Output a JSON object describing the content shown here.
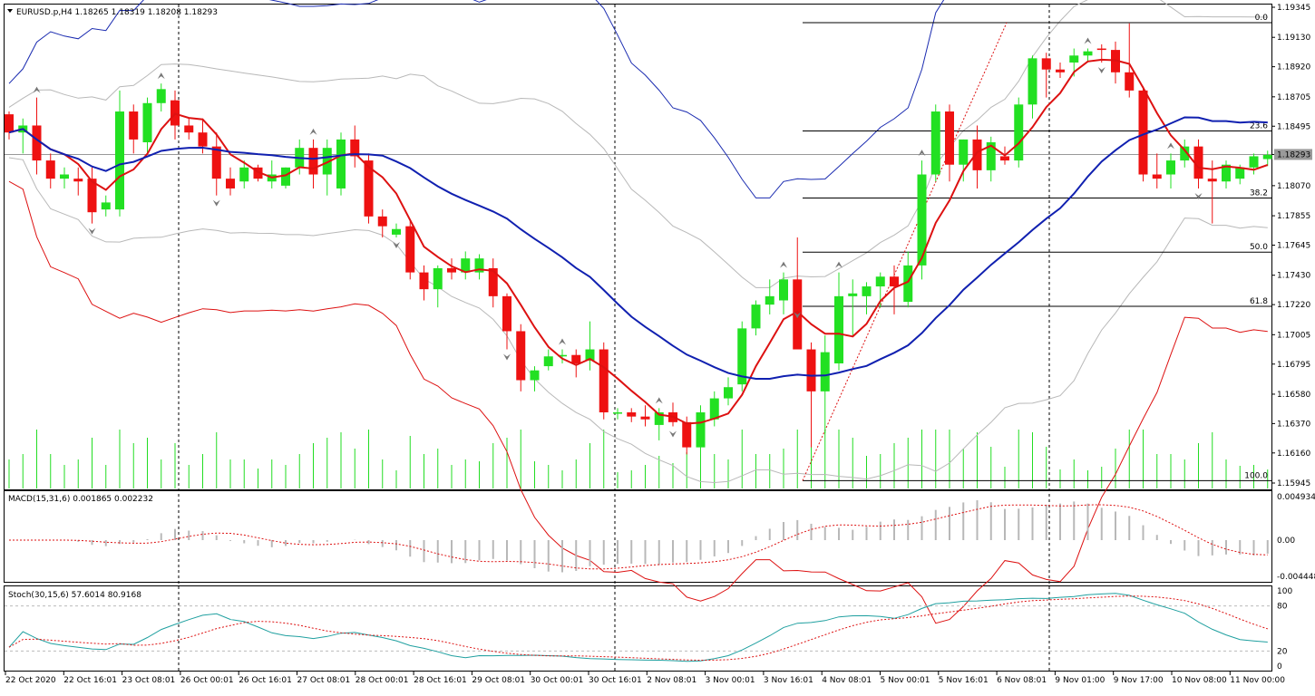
{
  "header": {
    "main": "EURUSD.p,H4  1.18265 1.18319 1.18208 1.18293",
    "macd": "MACD(15,31,6) 0.001865 0.002232",
    "stoch": "Stoch(30,15,6) 57.6014 80.9168"
  },
  "colors": {
    "bull": "#22e022",
    "bear": "#ee1111",
    "ma_fast": "#dd1111",
    "ma_mid": "#1020b0",
    "bb_outer_upper": "#1a2bb0",
    "bb_outer_lower": "#dd1111",
    "bb_inner": "#b8b8b8",
    "fibo": "#000000",
    "stoch_main": "#20a0a0",
    "stoch_signal": "#dd1111",
    "macd_hist": "#b8b8b8",
    "macd_signal": "#dd1111"
  },
  "price_axis": {
    "labels": [
      "1.19345",
      "1.19130",
      "1.18920",
      "1.18705",
      "1.18495",
      "1.18293",
      "1.18070",
      "1.17855",
      "1.17645",
      "1.17430",
      "1.17220",
      "1.17005",
      "1.16795",
      "1.16580",
      "1.16370",
      "1.16160",
      "1.15945"
    ],
    "current_price": "1.18293"
  },
  "macd_axis": [
    "0.004934",
    "0.00",
    "-0.004448"
  ],
  "stoch_axis": [
    "100",
    "80",
    "20",
    "0"
  ],
  "time_axis": [
    "22 Oct 2020",
    "22 Oct 16:01",
    "23 Oct 08:01",
    "26 Oct 00:01",
    "26 Oct 16:01",
    "27 Oct 08:01",
    "28 Oct 00:01",
    "28 Oct 16:01",
    "29 Oct 08:01",
    "30 Oct 00:01",
    "30 Oct 16:01",
    "2 Nov 08:01",
    "3 Nov 00:01",
    "3 Nov 16:01",
    "4 Nov 08:01",
    "5 Nov 00:01",
    "5 Nov 16:01",
    "6 Nov 08:01",
    "9 Nov 01:00",
    "9 Nov 17:00",
    "10 Nov 08:00",
    "11 Nov 00:00"
  ],
  "fibo_levels": [
    {
      "label": "0.0",
      "price": 1.19235
    },
    {
      "label": "23.6",
      "price": 1.18461
    },
    {
      "label": "38.2",
      "price": 1.17982
    },
    {
      "label": "50.0",
      "price": 1.17595
    },
    {
      "label": "61.8",
      "price": 1.17208
    },
    {
      "label": "100.0",
      "price": 1.15962
    }
  ],
  "chart_data": {
    "type": "candlestick",
    "symbol": "EURUSD.p",
    "timeframe": "H4",
    "ohlc_last": {
      "open": 1.18265,
      "high": 1.18319,
      "low": 1.18208,
      "close": 1.18293
    },
    "ylim": [
      1.15945,
      1.19345
    ],
    "candles": [
      [
        1.1858,
        1.186,
        1.184,
        1.1845
      ],
      [
        1.1845,
        1.1855,
        1.183,
        1.185
      ],
      [
        1.185,
        1.187,
        1.1815,
        1.1825
      ],
      [
        1.1825,
        1.183,
        1.1805,
        1.1812
      ],
      [
        1.1812,
        1.182,
        1.1805,
        1.1815
      ],
      [
        1.1812,
        1.182,
        1.18,
        1.181
      ],
      [
        1.1812,
        1.182,
        1.178,
        1.1788
      ],
      [
        1.179,
        1.18,
        1.1785,
        1.1795
      ],
      [
        1.179,
        1.1875,
        1.1785,
        1.186
      ],
      [
        1.186,
        1.1865,
        1.183,
        1.184
      ],
      [
        1.1838,
        1.187,
        1.183,
        1.1866
      ],
      [
        1.1866,
        1.188,
        1.186,
        1.1876
      ],
      [
        1.1868,
        1.1875,
        1.184,
        1.185
      ],
      [
        1.185,
        1.1855,
        1.184,
        1.1845
      ],
      [
        1.1845,
        1.1855,
        1.183,
        1.1835
      ],
      [
        1.1835,
        1.1845,
        1.18,
        1.1812
      ],
      [
        1.1812,
        1.182,
        1.18,
        1.1805
      ],
      [
        1.181,
        1.1825,
        1.1805,
        1.182
      ],
      [
        1.182,
        1.1822,
        1.181,
        1.1812
      ],
      [
        1.181,
        1.1825,
        1.1805,
        1.1815
      ],
      [
        1.1807,
        1.182,
        1.1805,
        1.182
      ],
      [
        1.182,
        1.184,
        1.1815,
        1.1834
      ],
      [
        1.1834,
        1.184,
        1.1805,
        1.1815
      ],
      [
        1.1815,
        1.184,
        1.18,
        1.1834
      ],
      [
        1.1805,
        1.1845,
        1.18,
        1.184
      ],
      [
        1.184,
        1.185,
        1.182,
        1.1828
      ],
      [
        1.1825,
        1.183,
        1.178,
        1.1785
      ],
      [
        1.1785,
        1.179,
        1.177,
        1.1778
      ],
      [
        1.1772,
        1.178,
        1.177,
        1.1776
      ],
      [
        1.1778,
        1.1782,
        1.174,
        1.1745
      ],
      [
        1.1745,
        1.175,
        1.1725,
        1.1733
      ],
      [
        1.1733,
        1.175,
        1.172,
        1.1748
      ],
      [
        1.1748,
        1.1755,
        1.174,
        1.1745
      ],
      [
        1.1745,
        1.176,
        1.174,
        1.1755
      ],
      [
        1.1745,
        1.1758,
        1.174,
        1.1755
      ],
      [
        1.1748,
        1.1755,
        1.172,
        1.1728
      ],
      [
        1.1728,
        1.173,
        1.169,
        1.1703
      ],
      [
        1.1703,
        1.1708,
        1.166,
        1.1668
      ],
      [
        1.1668,
        1.1678,
        1.166,
        1.1675
      ],
      [
        1.1678,
        1.169,
        1.1675,
        1.1685
      ],
      [
        1.1685,
        1.169,
        1.168,
        1.1686
      ],
      [
        1.1686,
        1.169,
        1.167,
        1.168
      ],
      [
        1.1682,
        1.171,
        1.1675,
        1.169
      ],
      [
        1.169,
        1.1695,
        1.164,
        1.1645
      ],
      [
        1.1645,
        1.1648,
        1.164,
        1.1645
      ],
      [
        1.1645,
        1.1648,
        1.1638,
        1.1642
      ],
      [
        1.1642,
        1.165,
        1.1635,
        1.164
      ],
      [
        1.1636,
        1.1648,
        1.1625,
        1.1645
      ],
      [
        1.1645,
        1.1652,
        1.1635,
        1.1638
      ],
      [
        1.1638,
        1.1642,
        1.1615,
        1.162
      ],
      [
        1.162,
        1.165,
        1.1615,
        1.1645
      ],
      [
        1.164,
        1.166,
        1.1635,
        1.1655
      ],
      [
        1.1655,
        1.167,
        1.165,
        1.1663
      ],
      [
        1.1665,
        1.171,
        1.166,
        1.1705
      ],
      [
        1.1705,
        1.1725,
        1.17,
        1.1722
      ],
      [
        1.1722,
        1.174,
        1.1715,
        1.1728
      ],
      [
        1.1725,
        1.1745,
        1.1715,
        1.174
      ],
      [
        1.174,
        1.177,
        1.172,
        1.169
      ],
      [
        1.169,
        1.1695,
        1.162,
        1.166
      ],
      [
        1.166,
        1.17,
        1.163,
        1.1688
      ],
      [
        1.168,
        1.1745,
        1.1675,
        1.1728
      ],
      [
        1.1728,
        1.174,
        1.17,
        1.173
      ],
      [
        1.1728,
        1.1738,
        1.1715,
        1.1735
      ],
      [
        1.1735,
        1.1745,
        1.172,
        1.1742
      ],
      [
        1.1742,
        1.175,
        1.1715,
        1.1735
      ],
      [
        1.1724,
        1.176,
        1.172,
        1.175
      ],
      [
        1.175,
        1.1825,
        1.174,
        1.1815
      ],
      [
        1.1815,
        1.1865,
        1.181,
        1.186
      ],
      [
        1.186,
        1.1865,
        1.181,
        1.1822
      ],
      [
        1.1822,
        1.184,
        1.181,
        1.184
      ],
      [
        1.184,
        1.185,
        1.1805,
        1.1818
      ],
      [
        1.1818,
        1.1842,
        1.181,
        1.1838
      ],
      [
        1.1828,
        1.1835,
        1.1822,
        1.1825
      ],
      [
        1.1825,
        1.187,
        1.182,
        1.1865
      ],
      [
        1.1865,
        1.19,
        1.1855,
        1.1898
      ],
      [
        1.1898,
        1.1902,
        1.187,
        1.189
      ],
      [
        1.189,
        1.1895,
        1.1884,
        1.1888
      ],
      [
        1.1895,
        1.1905,
        1.1885,
        1.19
      ],
      [
        1.19,
        1.1905,
        1.1895,
        1.1903
      ],
      [
        1.1905,
        1.1908,
        1.1895,
        1.1904
      ],
      [
        1.1904,
        1.191,
        1.188,
        1.1888
      ],
      [
        1.1888,
        1.1923,
        1.187,
        1.1875
      ],
      [
        1.1875,
        1.1878,
        1.181,
        1.1815
      ],
      [
        1.1815,
        1.183,
        1.1805,
        1.1812
      ],
      [
        1.1815,
        1.183,
        1.1805,
        1.1825
      ],
      [
        1.1825,
        1.184,
        1.182,
        1.1835
      ],
      [
        1.1835,
        1.184,
        1.1805,
        1.1812
      ],
      [
        1.1812,
        1.1825,
        1.178,
        1.181
      ],
      [
        1.181,
        1.1825,
        1.1805,
        1.1822
      ],
      [
        1.1812,
        1.1822,
        1.1808,
        1.182
      ],
      [
        1.182,
        1.183,
        1.1815,
        1.1828
      ],
      [
        1.1826,
        1.1832,
        1.1821,
        1.1829
      ]
    ]
  }
}
